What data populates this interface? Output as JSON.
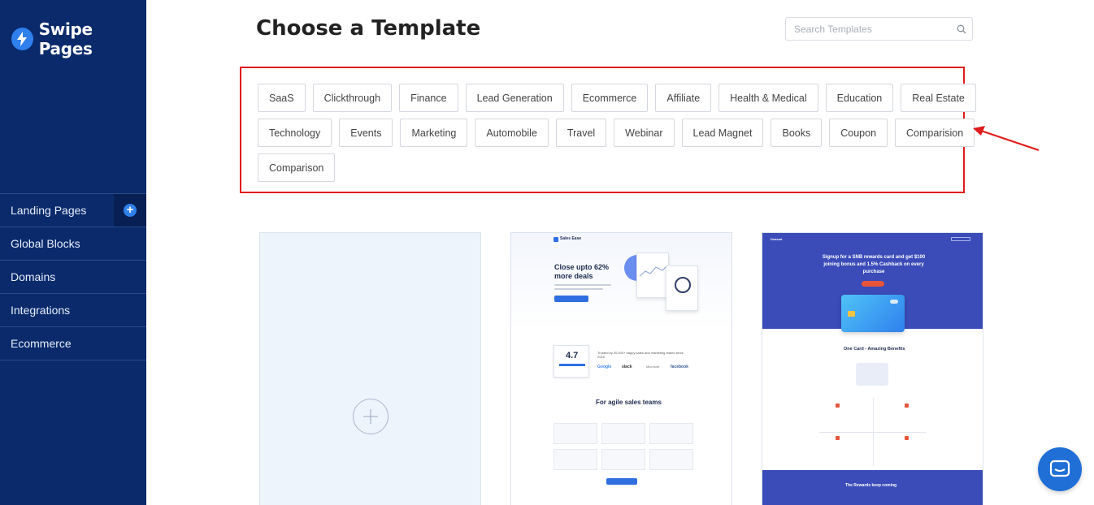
{
  "brand": {
    "name": "Swipe Pages",
    "color": "#0a2a6b",
    "accent": "#2f80ed"
  },
  "sidebar": {
    "items": [
      {
        "label": "Landing Pages",
        "has_add": true
      },
      {
        "label": "Global Blocks"
      },
      {
        "label": "Domains"
      },
      {
        "label": "Integrations"
      },
      {
        "label": "Ecommerce"
      }
    ]
  },
  "header": {
    "title": "Choose a Template",
    "search_placeholder": "Search Templates"
  },
  "categories": {
    "row1": [
      "SaaS",
      "Clickthrough",
      "Finance",
      "Lead Generation",
      "Ecommerce",
      "Affiliate",
      "Health & Medical",
      "Education",
      "Real Estate"
    ],
    "row2": [
      "Technology",
      "Events",
      "Marketing",
      "Automobile",
      "Travel",
      "Webinar",
      "Lead Magnet",
      "Books",
      "Coupon",
      "Comparision"
    ],
    "row3": [
      "Comparison"
    ]
  },
  "templates": {
    "t1": {
      "logo": "Sales Ease",
      "headline": "Close upto 62% more deals",
      "rating": "4.7",
      "trusted": "Trusted by 20,000+ happy sales and marketing teams since 2015",
      "brands": [
        "Google",
        "slack",
        "Microsoft",
        "facebook"
      ],
      "section": "For agile sales teams"
    },
    "t2": {
      "logo": "Dvasmt",
      "headline": "Signup for a SNB rewards card and get $100 joining bonus and 1.5% Cashback on every purchase",
      "benefits": "One Card - Amazing Benefits",
      "footer": "The Rewards keep coming"
    }
  },
  "highlight_color": "#e01b1b"
}
